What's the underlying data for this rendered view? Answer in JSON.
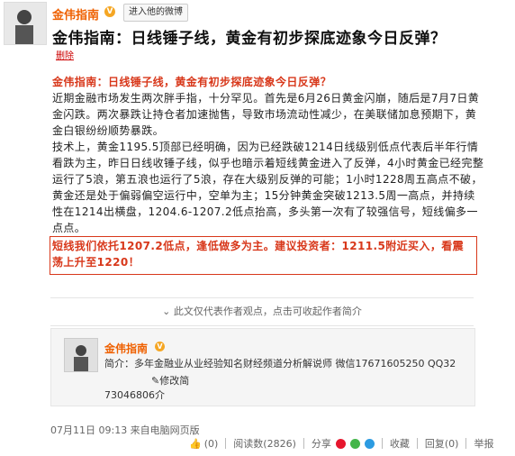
{
  "header": {
    "author": "金伟指南",
    "visit_button": "进入他的微博",
    "title": "金伟指南：日线锤子线，黄金有初步探底迹象今日反弹？",
    "delete_link": "删除"
  },
  "article": {
    "headline": "金伟指南：日线锤子线，黄金有初步探底迹象今日反弹？",
    "para1": "近期金融市场发生两次胖手指，十分罕见。首先是6月26日黄金闪崩，随后是7月7日黄金闪跌。两次暴跌让持仓者加速抛售，导致市场流动性减少，在美联储加息预期下，黄金白银纷纷顺势暴跌。",
    "para2": "技术上，黄金1195.5顶部已经明确，因为已经跌破1214日线级别低点代表后半年行情看跌为主，昨日日线收锤子线，似乎也暗示着短线黄金进入了反弹，4小时黄金已经完整运行了5浪，第五浪也运行了5浪，存在大级别反弹的可能；1小时1228周五高点不破，黄金还是处于偏弱偏空运行中，空单为主；15分钟黄金突破1213.5周一高点，并持续性在1214出横盘，1204.6-1207.2低点抬高，多头第一次有了较强信号，短线偏多一点点。",
    "advice": "短线我们依托1207.2低点，逢低做多为主。建议投资者：1211.5附近买入，看震荡上升至1220！"
  },
  "disclaimer": "此文仅代表作者观点，点击可收起作者简介",
  "card": {
    "name": "金伟指南",
    "intro": "简介：多年金融业从业经验知名财经频道分析解说师 微信17671605250 QQ32",
    "edit": "修改简",
    "intro_tail": "73046806介"
  },
  "footer": {
    "time": "07月11日  09:13  来自电脑网页版",
    "like_count": "(0)",
    "read": "阅读数(2826)",
    "share": "分享",
    "favorite": "收藏",
    "reply": "回复(0)",
    "report": "举报"
  },
  "colors": {
    "author_orange": "#ef6000",
    "highlight_red": "#d8381b",
    "vip_badge": "#f5a623"
  }
}
